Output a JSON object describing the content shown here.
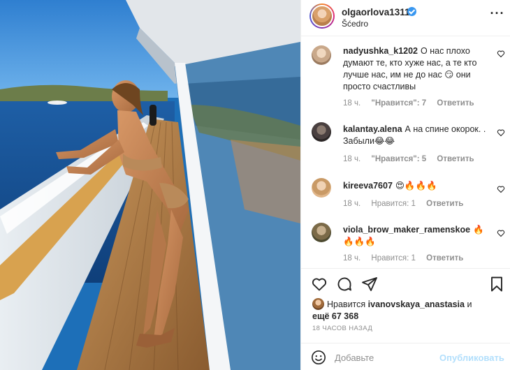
{
  "post": {
    "username": "olgaorlova1311",
    "location": "Šćedro"
  },
  "comments": [
    {
      "user": "nadyushka_k1202",
      "text": "О нас плохо думают те, кто хуже нас, а те кто лучше нас, им не до нас 😏 они просто счастливы",
      "age": "18 ч.",
      "likes": "\"Нравится\": 7",
      "reply": "Ответить"
    },
    {
      "user": "kalantay.alena",
      "text": "А на спине окорок. . Забыли😂😂",
      "age": "18 ч.",
      "likes": "\"Нравится\": 5",
      "reply": "Ответить"
    },
    {
      "user": "kireeva7607",
      "text": "😍🔥🔥🔥",
      "age": "18 ч.",
      "likes": "Нравится: 1",
      "reply": "Ответить"
    },
    {
      "user": "viola_brow_maker_ramenskoe",
      "text": "🔥🔥🔥🔥",
      "age": "18 ч.",
      "likes": "Нравится: 1",
      "reply": "Ответить"
    }
  ],
  "likes": {
    "prefix": "Нравится",
    "liker": "ivanovskaya_anastasia",
    "connector": "и",
    "count": "ещё 67 368"
  },
  "time_ago": "18 часов назад",
  "add_comment": {
    "placeholder": "Добавьте",
    "publish_label": "Опубликовать"
  },
  "icons": {
    "verified": "verified-badge-icon",
    "more": "more-options-icon",
    "heart": "heart-icon",
    "comment": "comment-icon",
    "share": "share-icon",
    "bookmark": "bookmark-icon",
    "emoji": "emoji-icon"
  },
  "colors": {
    "verified": "#3897f0",
    "publish_disabled": "#b2dffc",
    "secondary_text": "#8e8e8e"
  }
}
